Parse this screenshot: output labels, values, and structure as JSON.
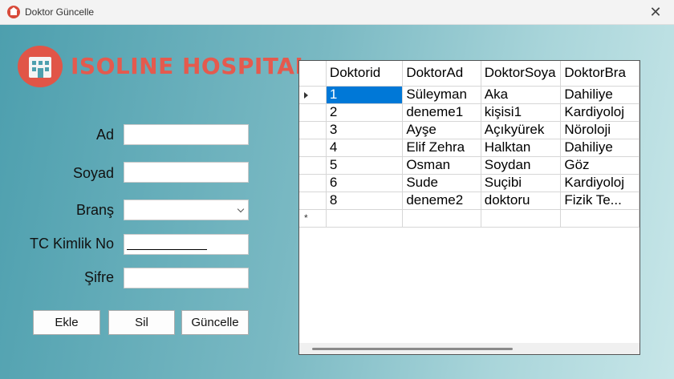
{
  "window": {
    "title": "Doktor Güncelle",
    "close_label": "✕"
  },
  "logo": {
    "text": "ISOLINE HOSPITAL",
    "icon": "hospital-icon"
  },
  "form": {
    "ad_label": "Ad",
    "soyad_label": "Soyad",
    "brans_label": "Branş",
    "tc_label": "TC Kimlik No",
    "sifre_label": "Şifre",
    "ad_value": "",
    "soyad_value": "",
    "brans_value": "",
    "tc_value": "",
    "sifre_value": ""
  },
  "buttons": {
    "ekle": "Ekle",
    "sil": "Sil",
    "guncelle": "Güncelle"
  },
  "grid": {
    "columns": [
      "Doktorid",
      "DoktorAd",
      "DoktorSoya",
      "DoktorBra"
    ],
    "rows": [
      [
        "1",
        "Süleyman",
        "Aka",
        "Dahiliye"
      ],
      [
        "2",
        "deneme1",
        "kişisi1",
        "Kardiyoloj"
      ],
      [
        "3",
        "Ayşe",
        "Açıkyürek",
        "Nöroloji"
      ],
      [
        "4",
        "Elif Zehra",
        "Halktan",
        "Dahiliye"
      ],
      [
        "5",
        "Osman",
        "Soydan",
        "Göz"
      ],
      [
        "6",
        "Sude",
        "Suçibi",
        "Kardiyoloj"
      ],
      [
        "8",
        "deneme2",
        "doktoru",
        "Fizik Te..."
      ]
    ],
    "new_row_marker": "*"
  },
  "colors": {
    "accent": "#0078d7",
    "logo_red": "#e45a4e",
    "bg_start": "#4d9fae",
    "bg_end": "#c7e6e8"
  }
}
